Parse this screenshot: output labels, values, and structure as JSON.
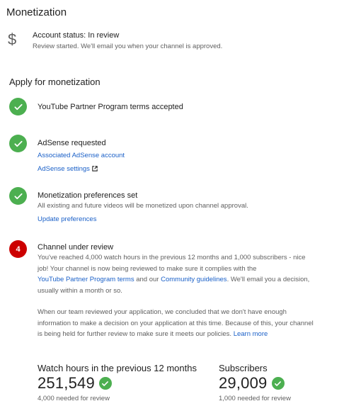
{
  "header": {
    "title": "Monetization"
  },
  "account_status": {
    "icon": "dollar-icon",
    "title": "Account status: In review",
    "subtitle": "Review started. We'll email you when your channel is approved."
  },
  "apply": {
    "title": "Apply for monetization",
    "steps": [
      {
        "title": "YouTube Partner Program terms accepted",
        "state": "complete"
      },
      {
        "title": "AdSense requested",
        "state": "complete",
        "links": [
          "Associated AdSense account",
          "AdSense settings"
        ]
      },
      {
        "title": "Monetization preferences set",
        "state": "complete",
        "text": "All existing and future videos will be monetized upon channel approval.",
        "links": [
          "Update preferences"
        ]
      },
      {
        "title": "Channel under review",
        "state": "in-progress",
        "number": "4",
        "p1_a": "You've reached 4,000 watch hours in the previous 12 months and 1,000 subscribers - nice job! Your channel is now being reviewed to make sure it complies with the ",
        "p1_link1": "YouTube Partner Program terms",
        "p1_b": " and our ",
        "p1_link2": "Community guidelines",
        "p1_c": ". We'll email you a decision, usually within a month or so.",
        "p2_a": "When our team reviewed your application, we concluded that we don't have enough information to make a decision on your application at this time. Because of this, your channel is being held for further review to make sure it meets our policies. ",
        "p2_link": "Learn more"
      }
    ]
  },
  "stats": [
    {
      "label": "Watch hours in the previous 12 months",
      "value": "251,549",
      "requirement": "4,000 needed for review"
    },
    {
      "label": "Subscribers",
      "value": "29,009",
      "requirement": "1,000 needed for review"
    }
  ],
  "colors": {
    "success": "#4caf50",
    "alert": "#cc0000",
    "link": "#1a60c8"
  }
}
